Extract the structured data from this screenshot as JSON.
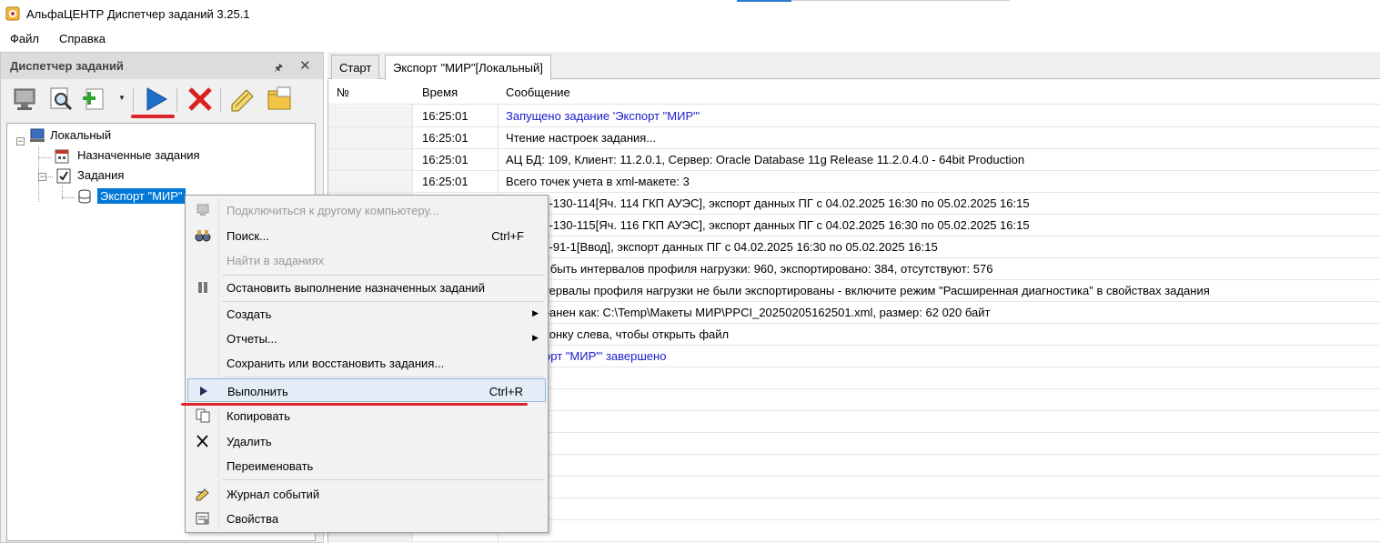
{
  "window": {
    "title": "АльфаЦЕНТР Диспетчер заданий 3.25.1",
    "icon": "app-icon"
  },
  "menu": [
    "Файл",
    "Справка"
  ],
  "left_panel": {
    "title": "Диспетчер заданий",
    "pin_icon": "pin-icon",
    "close_icon": "close-icon",
    "toolbar_icons": [
      "computer-icon",
      "search-icon",
      "add-icon",
      "run-icon",
      "delete-icon",
      "rename-icon",
      "folder-icon"
    ],
    "tree": {
      "local": "Локальный",
      "scheduled": "Назначенные задания",
      "tasks": "Задания",
      "task_export": "Экспорт \"МИР\""
    }
  },
  "tabs": [
    "Старт",
    "Экспорт \"МИР\"[Локальный]"
  ],
  "log": {
    "columns": [
      "№",
      "Время",
      "Сообщение"
    ],
    "rows": [
      {
        "time": "16:25:01",
        "msg": "Запущено задание 'Экспорт \"МИР\"'",
        "blue": true
      },
      {
        "time": "16:25:01",
        "msg": "Чтение настроек задания...",
        "blue": false
      },
      {
        "time": "16:25:01",
        "msg": "АЦ БД: 109, Клиент: 11.2.0.1, Сервер: Oracle Database 11g Release 11.2.0.4.0 - 64bit Production",
        "blue": false
      },
      {
        "time": "16:25:01",
        "msg": "Всего точек учета в xml-макете: 3",
        "blue": false
      },
      {
        "time": "",
        "msg": "учета: 3-130-114[Яч. 114 ГКП АУЭС], экспорт данных ПГ с 04.02.2025 16:30 по 05.02.2025 16:15",
        "blue": false
      },
      {
        "time": "",
        "msg": "учета: 3-130-115[Яч. 116 ГКП АУЭС], экспорт данных ПГ с 04.02.2025 16:30 по 05.02.2025 16:15",
        "blue": false
      },
      {
        "time": "",
        "msg": "учета: 5-91-1[Ввод], экспорт данных ПГ с 04.02.2025 16:30 по 05.02.2025 16:15",
        "blue": false
      },
      {
        "time": "",
        "msg": "должно быть интервалов профиля нагрузки: 960, экспортировано: 384, отсутствуют: 576",
        "blue": false
      },
      {
        "time": "",
        "msg": "рые интервалы профиля нагрузки не были экспортированы - включите режим \"Расширенная диагностика\" в свойствах задания",
        "blue": false
      },
      {
        "time": "",
        "msg": "ыл сохранен как: C:\\Temp\\Макеты МИР\\PPCI_20250205162501.xml, размер: 62 020 байт",
        "blue": false
      },
      {
        "time": "",
        "msg": "те на иконку слева, чтобы открыть файл",
        "blue": false
      },
      {
        "time": "",
        "msg": "е 'Экспорт \"МИР\"' завершено",
        "blue": true
      }
    ]
  },
  "context_menu": [
    {
      "label": "Подключиться к другому компьютеру...",
      "shortcut": "",
      "icon": "connect-icon",
      "disabled": true
    },
    {
      "label": "Поиск...",
      "shortcut": "Ctrl+F",
      "icon": "binoculars-icon",
      "disabled": false
    },
    {
      "label": "Найти в заданиях",
      "shortcut": "",
      "icon": "",
      "disabled": true
    },
    {
      "label": "Остановить выполнение назначенных заданий",
      "shortcut": "",
      "icon": "stop-icon",
      "disabled": false
    },
    {
      "label": "Создать",
      "shortcut": "",
      "icon": "",
      "disabled": false,
      "submenu": true
    },
    {
      "label": "Отчеты...",
      "shortcut": "",
      "icon": "",
      "disabled": false,
      "submenu": true
    },
    {
      "label": "Сохранить или восстановить задания...",
      "shortcut": "",
      "icon": "",
      "disabled": false
    },
    {
      "label": "Выполнить",
      "shortcut": "Ctrl+R",
      "icon": "play-icon",
      "disabled": false,
      "highlighted": true
    },
    {
      "label": "Копировать",
      "shortcut": "",
      "icon": "copy-icon",
      "disabled": false
    },
    {
      "label": "Удалить",
      "shortcut": "",
      "icon": "delete-icon",
      "disabled": false
    },
    {
      "label": "Переименовать",
      "shortcut": "",
      "icon": "",
      "disabled": false
    },
    {
      "label": "Журнал событий",
      "shortcut": "",
      "icon": "journal-icon",
      "disabled": false
    },
    {
      "label": "Свойства",
      "shortcut": "",
      "icon": "properties-icon",
      "disabled": false
    }
  ],
  "colors": {
    "accent": "#0078d7",
    "annotation_red": "#e0242e",
    "log_blue": "#1a1acc"
  }
}
